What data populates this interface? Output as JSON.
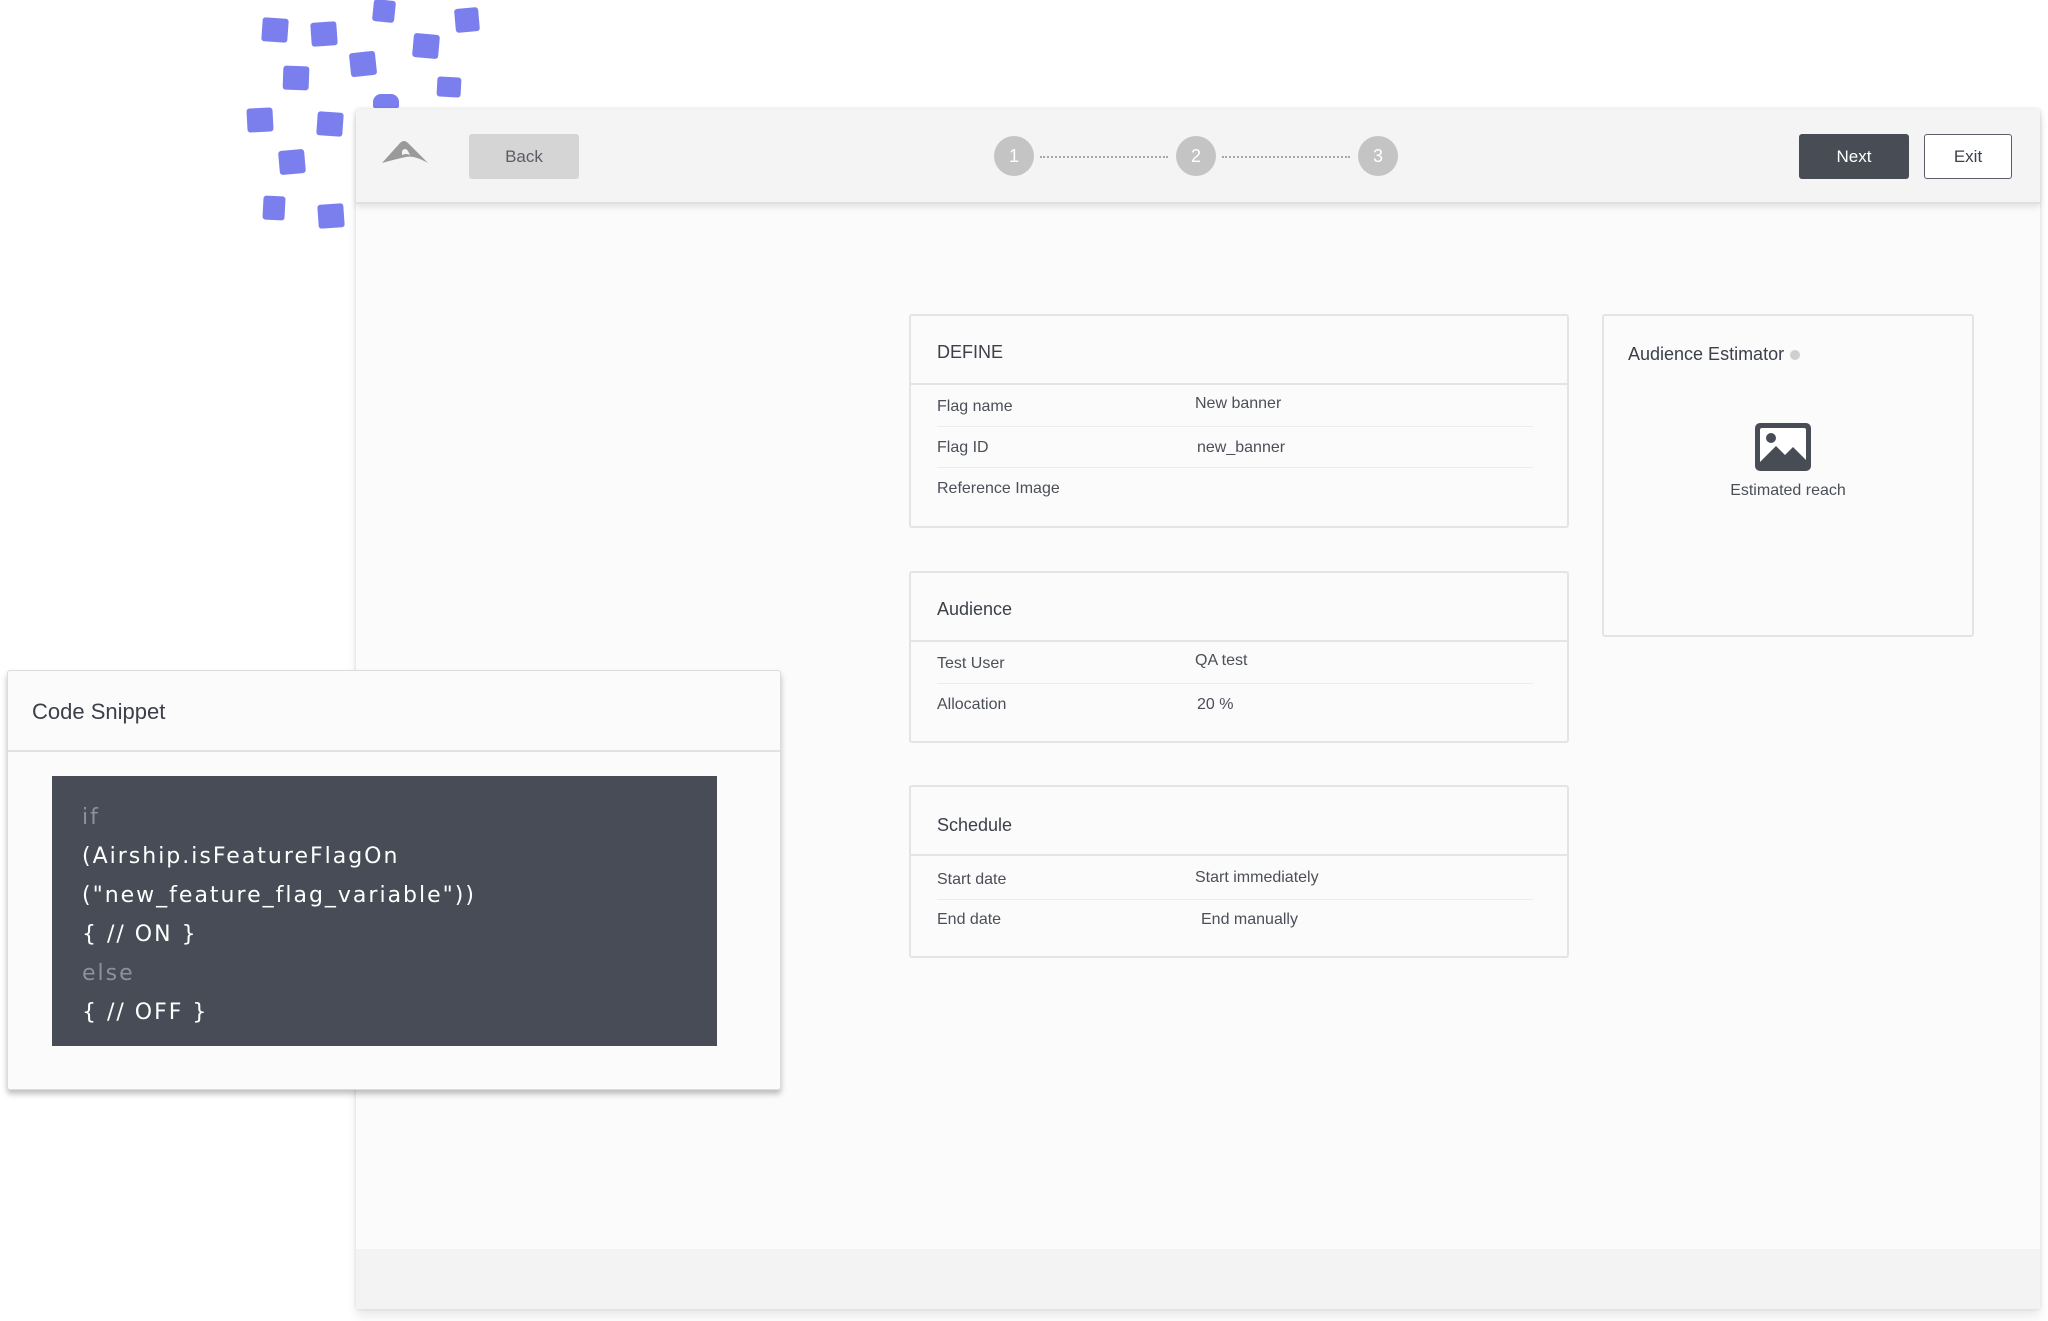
{
  "topbar": {
    "back_label": "Back",
    "next_label": "Next",
    "exit_label": "Exit",
    "steps": [
      "1",
      "2",
      "3"
    ]
  },
  "define": {
    "title": "DEFINE",
    "rows": [
      {
        "label": "Flag name",
        "value": "New banner"
      },
      {
        "label": "Flag ID",
        "value": "new_banner"
      },
      {
        "label": "Reference Image",
        "value": ""
      }
    ]
  },
  "audience": {
    "title": "Audience",
    "rows": [
      {
        "label": "Test User",
        "value": "QA test"
      },
      {
        "label": "Allocation",
        "value": "20 %"
      }
    ]
  },
  "schedule": {
    "title": "Schedule",
    "rows": [
      {
        "label": "Start date",
        "value": "Start immediately"
      },
      {
        "label": "End date",
        "value": "End manually"
      }
    ]
  },
  "estimator": {
    "title": "Audience Estimator",
    "icon": "image-icon",
    "caption": "Estimated reach"
  },
  "snippet": {
    "title": "Code Snippet",
    "lines": [
      "if",
      "(Airship.isFeatureFlagOn",
      "(\"new_feature_flag_variable\"))",
      "{ // ON }",
      "else",
      "{ // OFF }"
    ]
  },
  "colors": {
    "accent_squares": "#7b7fee",
    "dark_button": "#474c55",
    "code_background": "#474c56"
  }
}
